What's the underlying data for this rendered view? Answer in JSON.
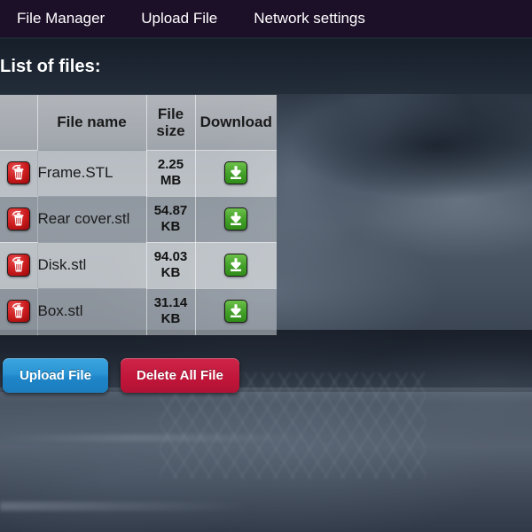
{
  "navbar": {
    "items": [
      {
        "label": "File Manager",
        "name": "nav-file-manager"
      },
      {
        "label": "Upload File",
        "name": "nav-upload-file"
      },
      {
        "label": "Network settings",
        "name": "nav-network-settings"
      }
    ]
  },
  "heading": "List of files:",
  "table": {
    "headers": {
      "delete": "",
      "file_name": "File name",
      "file_size": "File size",
      "download": "Download"
    },
    "rows": [
      {
        "file_name": "Frame.STL",
        "file_size": "2.25 MB",
        "delete_icon": "trash-icon",
        "download_icon": "download-icon"
      },
      {
        "file_name": "Rear cover.stl",
        "file_size": "54.87 KB",
        "delete_icon": "trash-icon",
        "download_icon": "download-icon"
      },
      {
        "file_name": "Disk.stl",
        "file_size": "94.03 KB",
        "delete_icon": "trash-icon",
        "download_icon": "download-icon"
      },
      {
        "file_name": "Box.stl",
        "file_size": "31.14 KB",
        "delete_icon": "trash-icon",
        "download_icon": "download-icon"
      }
    ]
  },
  "actions": {
    "upload_label": "Upload File",
    "delete_all_label": "Delete All File"
  },
  "colors": {
    "navbar_bg": "#1c0f28",
    "upload_button": "#2b94d4",
    "delete_button": "#c2163a",
    "download_icon": "#46a32b",
    "trash_icon": "#c91a1c",
    "text_light": "#ffffff",
    "table_text": "#1b1b1b"
  }
}
